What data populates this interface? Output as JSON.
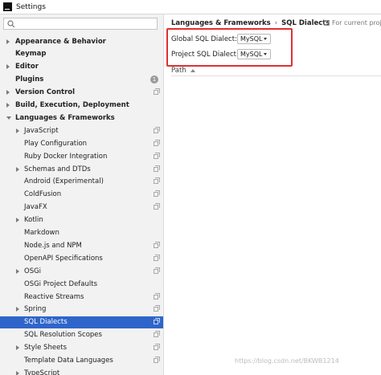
{
  "window": {
    "title": "Settings"
  },
  "sidebar": {
    "search_placeholder": "",
    "items": [
      {
        "label": "Appearance & Behavior",
        "bold": true,
        "arrow": "right",
        "indent": 0
      },
      {
        "label": "Keymap",
        "bold": true,
        "arrow": null,
        "indent": 0
      },
      {
        "label": "Editor",
        "bold": true,
        "arrow": "right",
        "indent": 0
      },
      {
        "label": "Plugins",
        "bold": true,
        "arrow": null,
        "indent": 0,
        "badge": "1"
      },
      {
        "label": "Version Control",
        "bold": true,
        "arrow": "right",
        "indent": 0,
        "copy": true
      },
      {
        "label": "Build, Execution, Deployment",
        "bold": true,
        "arrow": "right",
        "indent": 0
      },
      {
        "label": "Languages & Frameworks",
        "bold": true,
        "arrow": "down",
        "indent": 0
      },
      {
        "label": "JavaScript",
        "bold": false,
        "arrow": "right",
        "indent": 1,
        "copy": true
      },
      {
        "label": "Play Configuration",
        "bold": false,
        "arrow": null,
        "indent": 1,
        "copy": true
      },
      {
        "label": "Ruby Docker Integration",
        "bold": false,
        "arrow": null,
        "indent": 1,
        "copy": true
      },
      {
        "label": "Schemas and DTDs",
        "bold": false,
        "arrow": "right",
        "indent": 1,
        "copy": true
      },
      {
        "label": "Android (Experimental)",
        "bold": false,
        "arrow": null,
        "indent": 1,
        "copy": true
      },
      {
        "label": "ColdFusion",
        "bold": false,
        "arrow": null,
        "indent": 1,
        "copy": true
      },
      {
        "label": "JavaFX",
        "bold": false,
        "arrow": null,
        "indent": 1,
        "copy": true
      },
      {
        "label": "Kotlin",
        "bold": false,
        "arrow": "right",
        "indent": 1
      },
      {
        "label": "Markdown",
        "bold": false,
        "arrow": null,
        "indent": 1
      },
      {
        "label": "Node.js and NPM",
        "bold": false,
        "arrow": null,
        "indent": 1,
        "copy": true
      },
      {
        "label": "OpenAPI Specifications",
        "bold": false,
        "arrow": null,
        "indent": 1,
        "copy": true
      },
      {
        "label": "OSGi",
        "bold": false,
        "arrow": "right",
        "indent": 1,
        "copy": true
      },
      {
        "label": "OSGi Project Defaults",
        "bold": false,
        "arrow": null,
        "indent": 1
      },
      {
        "label": "Reactive Streams",
        "bold": false,
        "arrow": null,
        "indent": 1,
        "copy": true
      },
      {
        "label": "Spring",
        "bold": false,
        "arrow": "right",
        "indent": 1,
        "copy": true
      },
      {
        "label": "SQL Dialects",
        "bold": false,
        "arrow": null,
        "indent": 1,
        "copy": true,
        "selected": true
      },
      {
        "label": "SQL Resolution Scopes",
        "bold": false,
        "arrow": null,
        "indent": 1,
        "copy": true
      },
      {
        "label": "Style Sheets",
        "bold": false,
        "arrow": "right",
        "indent": 1,
        "copy": true
      },
      {
        "label": "Template Data Languages",
        "bold": false,
        "arrow": null,
        "indent": 1,
        "copy": true
      },
      {
        "label": "TypeScript",
        "bold": false,
        "arrow": "right",
        "indent": 1
      }
    ]
  },
  "main": {
    "breadcrumb": {
      "parent": "Languages & Frameworks",
      "separator": "›",
      "current": "SQL Dialects"
    },
    "for_current_project": "For current proj",
    "global_dialect": {
      "label": "Global SQL Dialect:",
      "value": "MySQL"
    },
    "project_dialect": {
      "label": "Project SQL Dialect:",
      "value": "MySQL"
    },
    "table": {
      "column": "Path"
    }
  },
  "watermark": "https://blog.csdn.net/BKWB1214",
  "colors": {
    "selection": "#2f65ca",
    "highlight_box": "#e03030",
    "sidebar_bg": "#f2f2f2"
  }
}
